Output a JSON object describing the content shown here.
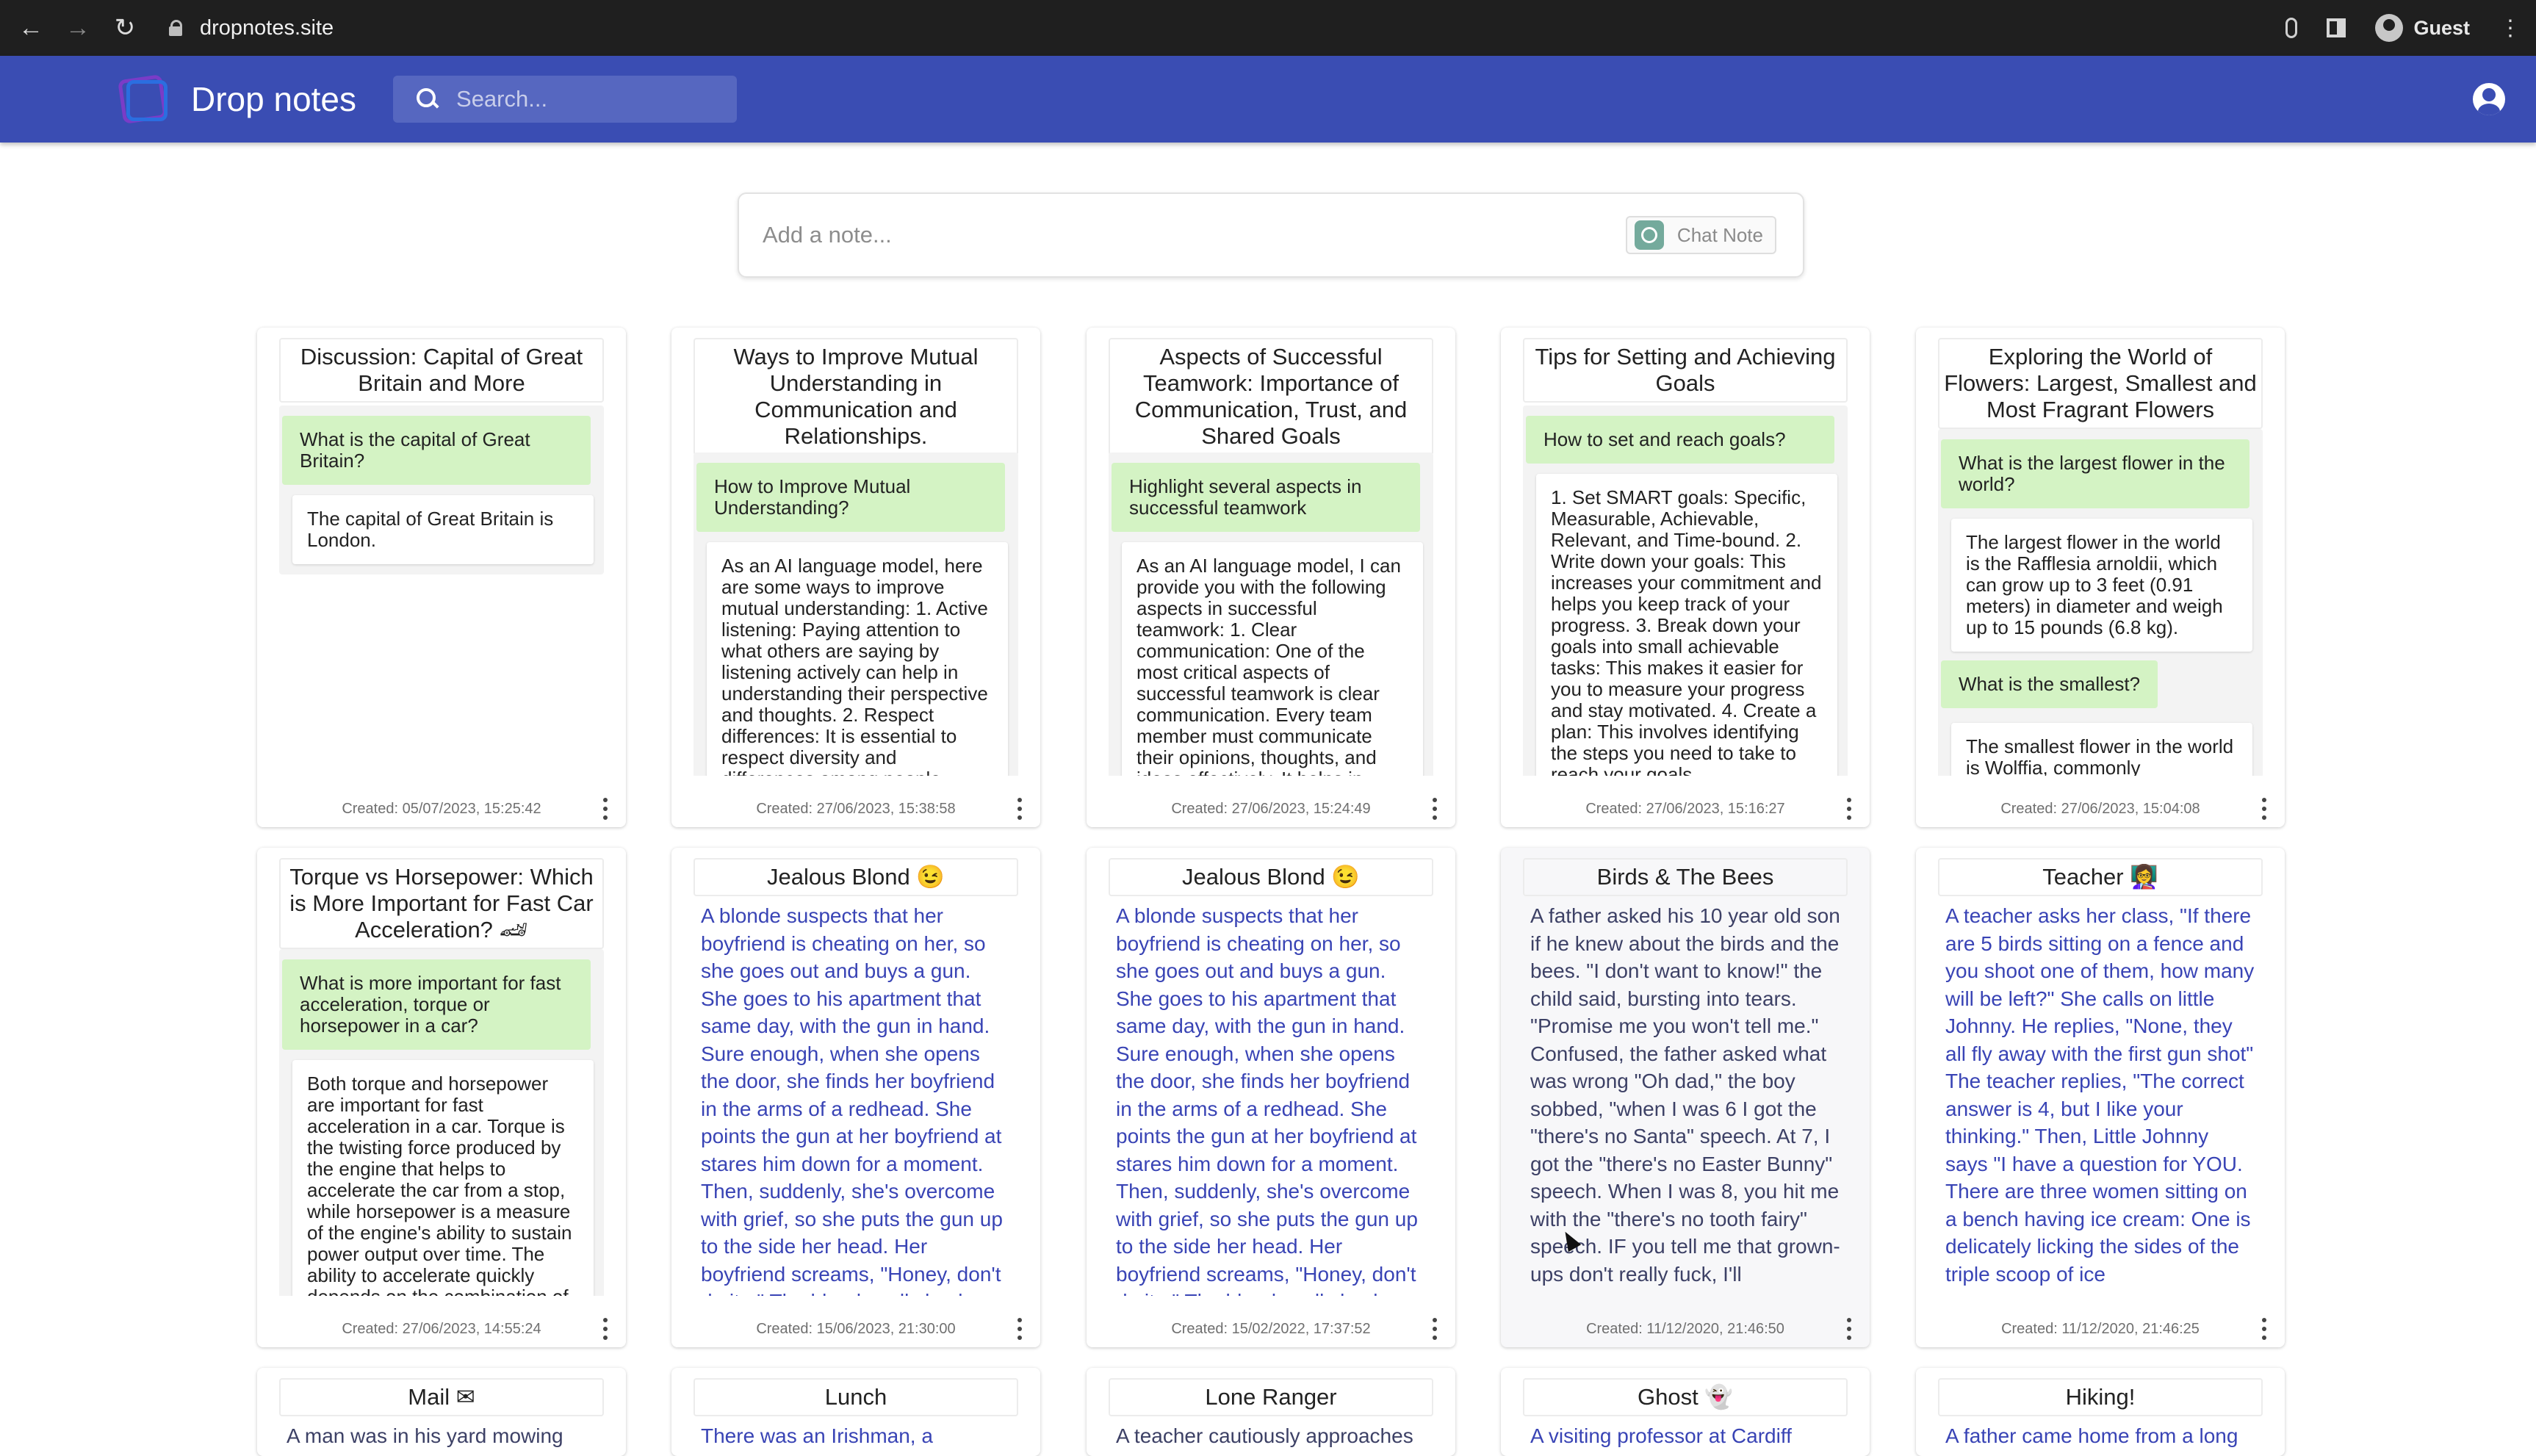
{
  "browser": {
    "url": "dropnotes.site",
    "profile": "Guest"
  },
  "app": {
    "title": "Drop notes",
    "search_placeholder": "Search...",
    "add_note_placeholder": "Add a note...",
    "chat_note_label": "Chat Note"
  },
  "notes": [
    {
      "title": "Discussion: Capital of Great Britain and More",
      "q1": "What is the capital of Great Britain?",
      "a1": "The capital of Great Britain is London.",
      "created": "Created: 05/07/2023, 15:25:42"
    },
    {
      "title": "Ways to Improve Mutual Understanding in Communication and Relationships.",
      "q1": "How to Improve Mutual Understanding?",
      "a1": "As an AI language model, here are some ways to improve mutual understanding: 1. Active listening: Paying attention to what others are saying by listening actively can help in understanding their perspective and thoughts. 2. Respect differences: It is essential to respect diversity and differences among people",
      "created": "Created: 27/06/2023, 15:38:58"
    },
    {
      "title": "Aspects of Successful Teamwork: Importance of Communication, Trust, and Shared Goals",
      "q1": "Highlight several aspects in successful teamwork",
      "a1": "As an AI language model, I can provide you with the following aspects in successful teamwork: 1. Clear communication: One of the most critical aspects of successful teamwork is clear communication. Every team member must communicate their opinions, thoughts, and ideas effectively. It helps in",
      "created": "Created: 27/06/2023, 15:24:49"
    },
    {
      "title": "Tips for Setting and Achieving Goals",
      "q1": "How to set and reach goals?",
      "a1": "1. Set SMART goals: Specific, Measurable, Achievable, Relevant, and Time-bound. 2. Write down your goals: This increases your commitment and helps you keep track of your progress. 3. Break down your goals into small achievable tasks: This makes it easier for you to measure your progress and stay motivated. 4. Create a plan: This involves identifying the steps you need to take to reach your goals,",
      "created": "Created: 27/06/2023, 15:16:27"
    },
    {
      "title": "Exploring the World of Flowers: Largest, Smallest and Most Fragrant Flowers",
      "q1": "What is the largest flower in the world?",
      "a1": "The largest flower in the world is the Rafflesia arnoldii, which can grow up to 3 feet (0.91 meters) in diameter and weigh up to 15 pounds (6.8 kg).",
      "q2": "What is the smallest?",
      "a2": "The smallest flower in the world is Wolffia, commonly",
      "created": "Created: 27/06/2023, 15:04:08"
    },
    {
      "title": "Torque vs Horsepower: Which is More Important for Fast Car Acceleration? 🏎",
      "q1": "What is more important for fast acceleration, torque or horsepower in a car?",
      "a1": "Both torque and horsepower are important for fast acceleration in a car. Torque is the twisting force produced by the engine that helps to accelerate the car from a stop, while horsepower is a measure of the engine's ability to sustain power output over time. The ability to accelerate quickly depends on the combination of",
      "created": "Created: 27/06/2023, 14:55:24"
    },
    {
      "title": "Jealous Blond 😉",
      "text": "A blonde suspects that her boyfriend is cheating on her, so she goes out and buys a gun. She goes to his apartment that same day, with the gun in hand. Sure enough, when she opens the door, she finds her boyfriend in the arms of a redhead. She points the gun at her boyfriend at stares him down for a moment. Then, suddenly, she's overcome with grief, so she puts the gun up to the side her head. Her boyfriend screams, \"Honey, don't do it...\" The blonde yells back",
      "created": "Created: 15/06/2023, 21:30:00"
    },
    {
      "title": "Jealous Blond 😉",
      "text": "A blonde suspects that her boyfriend is cheating on her, so she goes out and buys a gun. She goes to his apartment that same day, with the gun in hand. Sure enough, when she opens the door, she finds her boyfriend in the arms of a redhead. She points the gun at her boyfriend at stares him down for a moment. Then, suddenly, she's overcome with grief, so she puts the gun up to the side her head. Her boyfriend screams, \"Honey, don't do it...\" The blonde yells back",
      "created": "Created: 15/02/2022, 17:37:52"
    },
    {
      "title": "Birds & The Bees",
      "text": "A father asked his 10 year old son if he knew about the birds and the bees. \"I don't want to know!\" the child said, bursting into tears. \"Promise me you won't tell me.\" Confused, the father asked what was wrong \"Oh dad,\" the boy sobbed, \"when I was 6 I got the \"there's no Santa\" speech. At 7, I got the \"there's no Easter Bunny\" speech. When I was 8, you hit me with the \"there's no tooth fairy\" speech. IF you tell me that grown-ups don't really fuck, I'll",
      "created": "Created: 11/12/2020, 21:46:50"
    },
    {
      "title": "Teacher 👩‍🏫",
      "text": "A teacher asks her class, \"If there are 5 birds sitting on a fence and you shoot one of them, how many will be left?\" She calls on little Johnny. He replies, \"None, they all fly away with the first gun shot\" The teacher replies, \"The correct answer is 4, but I like your thinking.\" Then, Little Johnny says \"I have a question for YOU. There are three women sitting on a bench having ice cream: One is delicately licking the sides of the triple scoop of ice",
      "created": "Created: 11/12/2020, 21:46:25"
    },
    {
      "title": "Mail ✉",
      "text": "A man was in his yard mowing"
    },
    {
      "title": "Lunch",
      "text": "There was an Irishman, a"
    },
    {
      "title": "Lone Ranger",
      "text": "A teacher cautiously approaches"
    },
    {
      "title": "Ghost 👻",
      "text": "A visiting professor at Cardiff"
    },
    {
      "title": "Hiking!",
      "text": "A father came home from a long"
    }
  ]
}
